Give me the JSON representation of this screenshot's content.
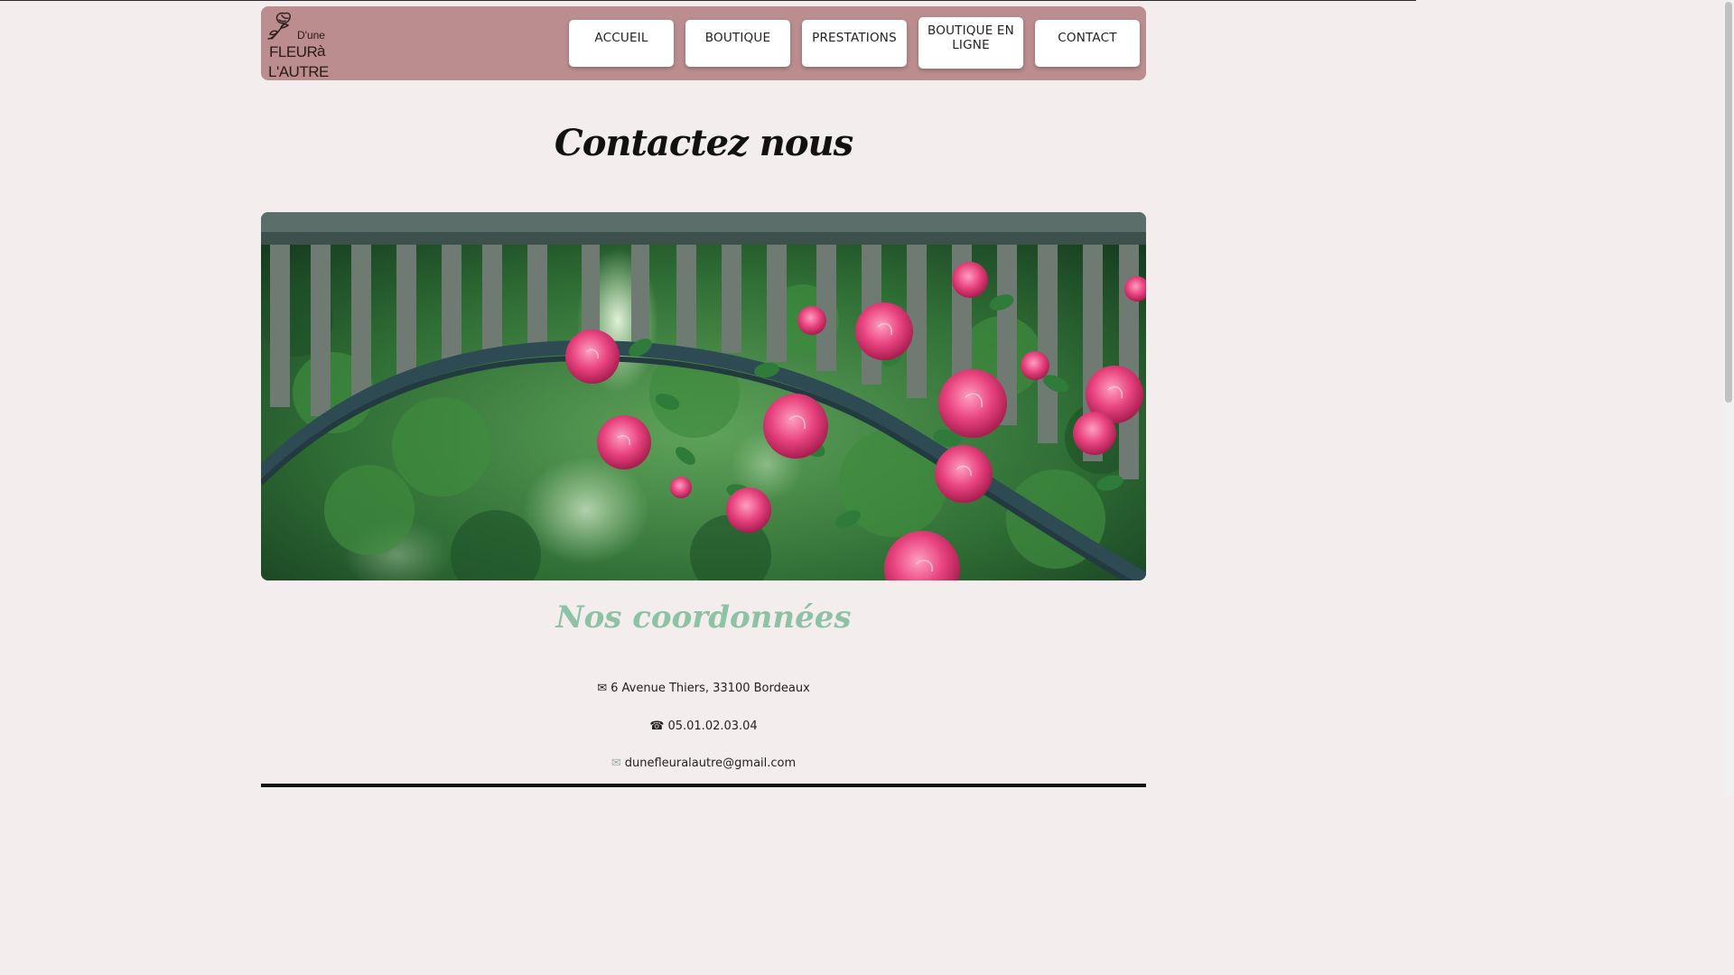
{
  "logo": {
    "line1": "D'une",
    "line2": "FLEUR",
    "line3": "à",
    "line4": "L'AUTRE"
  },
  "nav": {
    "items": [
      {
        "label": "ACCUEIL"
      },
      {
        "label": "BOUTIQUE"
      },
      {
        "label": "PRESTATIONS"
      },
      {
        "label": "BOUTIQUE EN LIGNE"
      },
      {
        "label": "CONTACT"
      }
    ]
  },
  "page": {
    "title": "Contactez nous"
  },
  "hero": {
    "icon": "rose-garden-photo"
  },
  "contact": {
    "title": "Nos coordonnées",
    "address": "6 Avenue Thiers, 33100 Bordeaux",
    "address_icon": "✉",
    "phone": "05.01.02.03.04",
    "phone_icon": "☎",
    "email": "dunefleuralautre@gmail.com",
    "email_icon": "✉"
  },
  "colors": {
    "background": "#f4eded",
    "header": "#bb8d8e",
    "accent_green": "#8ec2a4"
  }
}
